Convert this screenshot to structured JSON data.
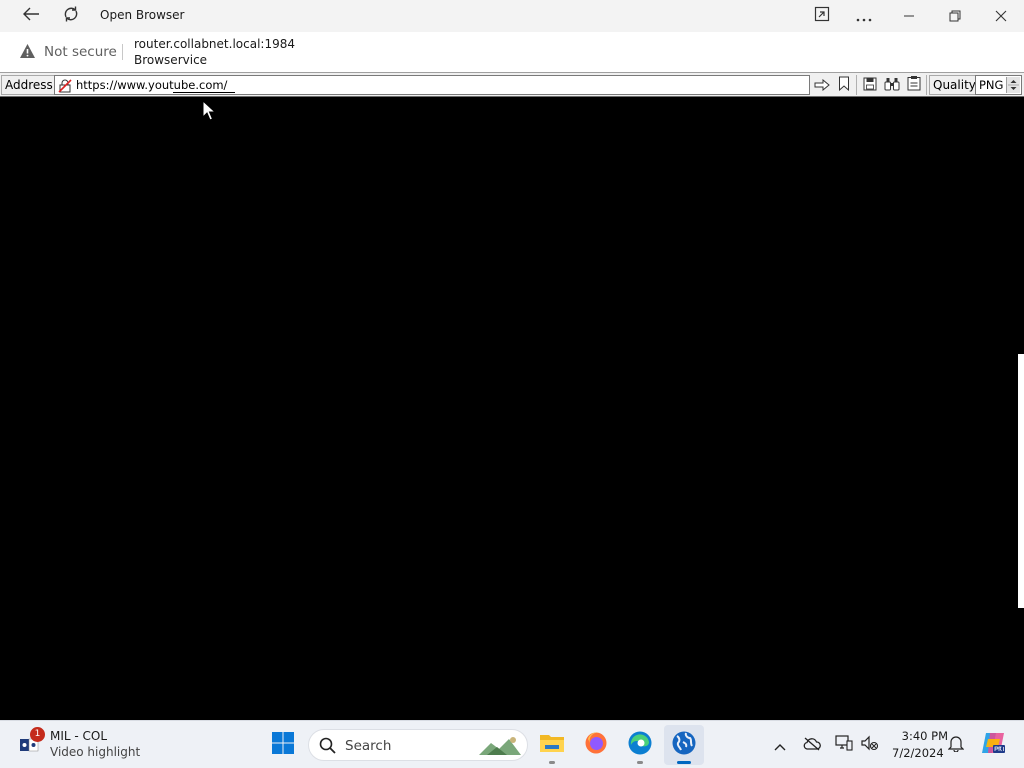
{
  "window": {
    "title": "Open Browser",
    "not_secure": "Not secure",
    "host": "router.collabnet.local:1984",
    "app_name": "Browservice"
  },
  "toolbar": {
    "address_label": "Address",
    "url": "https://www.youtube.com/",
    "quality_label": "Quality",
    "quality_value": "PNG"
  },
  "taskbar": {
    "widget": {
      "badge": "1",
      "title": "MIL - COL",
      "subtitle": "Video highlight"
    },
    "search_placeholder": "Search",
    "clock": {
      "time": "3:40 PM",
      "date": "7/2/2024"
    }
  }
}
